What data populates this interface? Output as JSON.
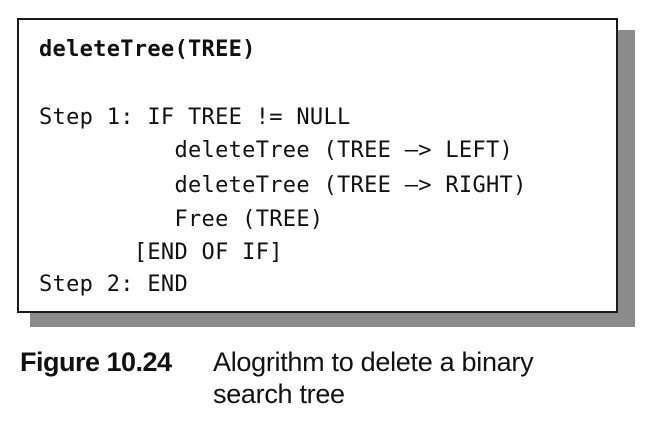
{
  "algorithm": {
    "title": "deleteTree(TREE)",
    "lines": [
      "Step 1: IF TREE != NULL",
      "          deleteTree (TREE –> LEFT)",
      "          deleteTree (TREE –> RIGHT)",
      "          Free (TREE)",
      "       [END OF IF]",
      "Step 2: END"
    ]
  },
  "caption": {
    "label": "Figure 10.24",
    "text_line1": "Alogrithm to delete a binary",
    "text_line2": "search tree"
  }
}
